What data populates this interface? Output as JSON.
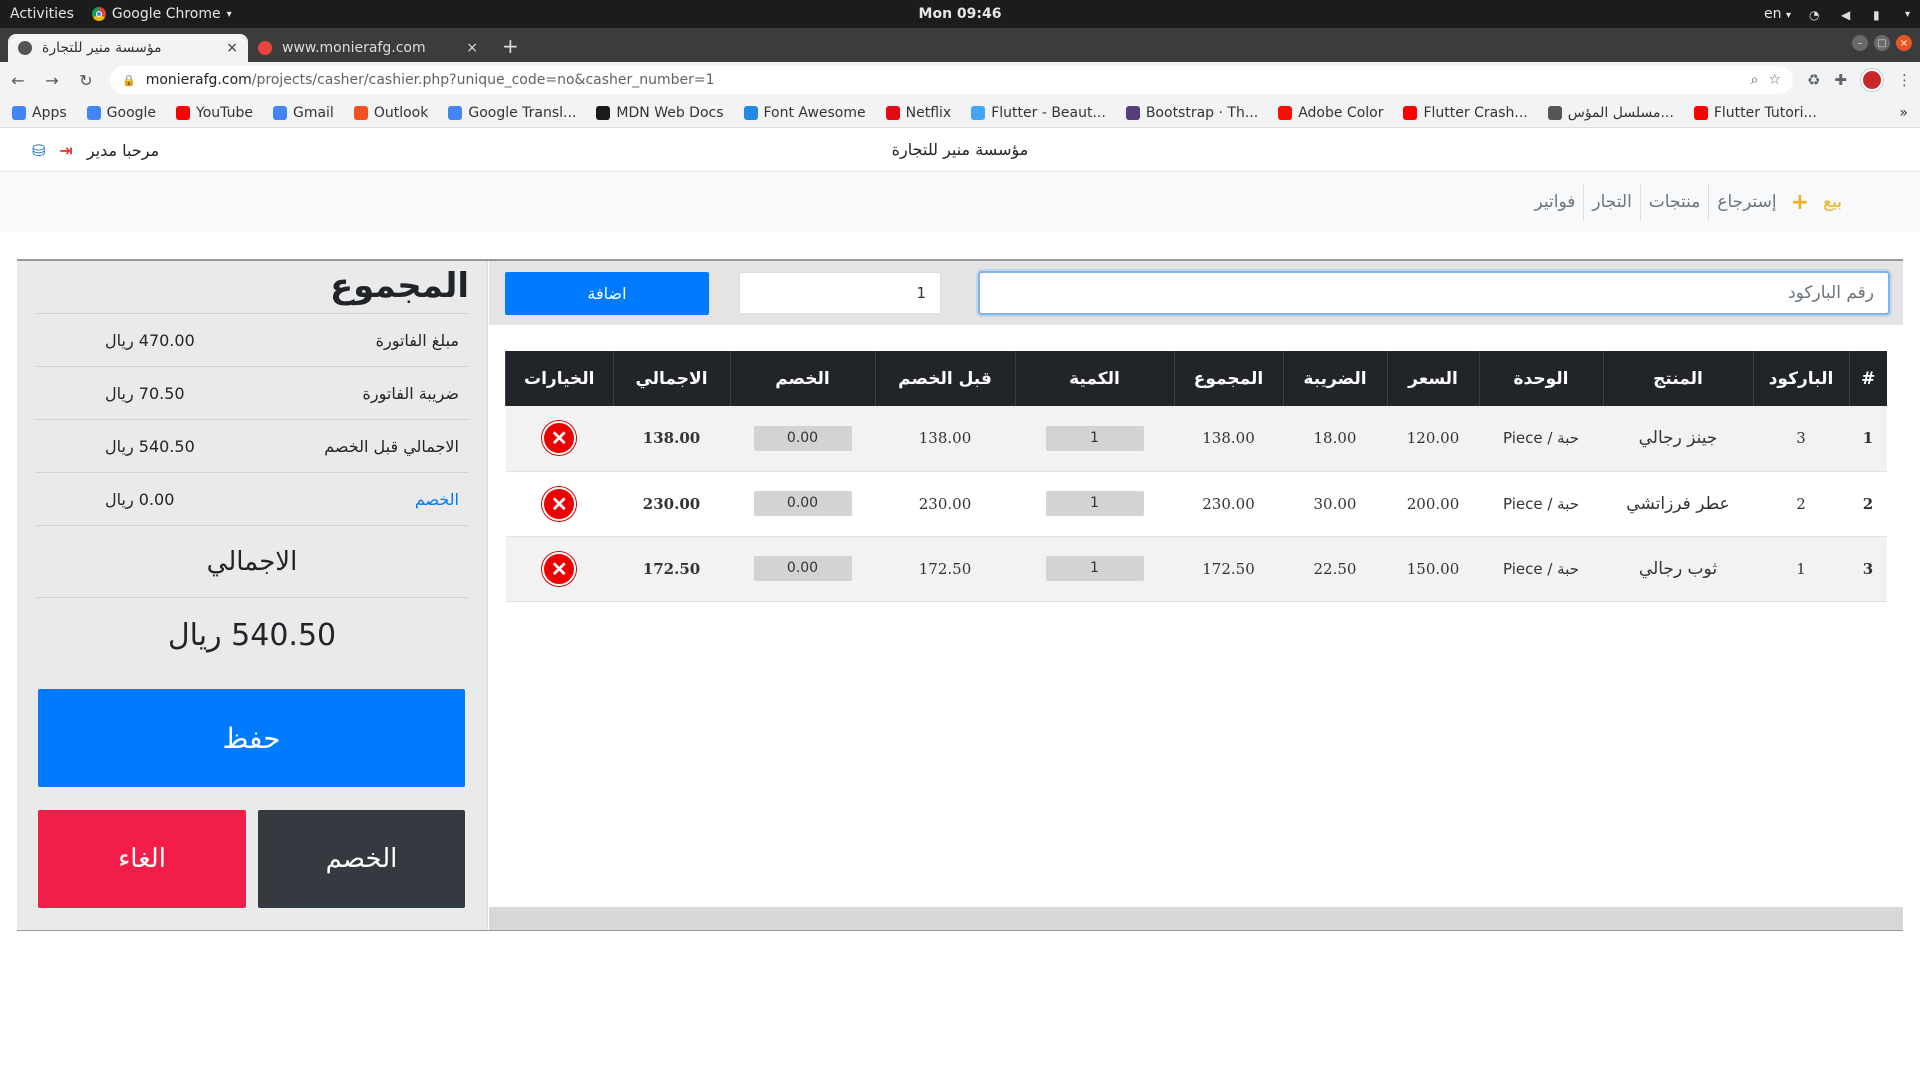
{
  "os": {
    "activities": "Activities",
    "app_name": "Google Chrome",
    "clock": "Mon 09:46",
    "lang": "en"
  },
  "tabs": [
    {
      "title": "مؤسسة منير للتجارة",
      "close": "×"
    },
    {
      "title": "www.monierafg.com",
      "close": "×"
    }
  ],
  "omnibox": {
    "host": "monierafg.com",
    "path": "/projects/casher/cashier.php?unique_code=no&casher_number=1"
  },
  "bookmarks": [
    {
      "label": "Apps",
      "color": "#4285f4"
    },
    {
      "label": "Google",
      "color": "#4285f4"
    },
    {
      "label": "YouTube",
      "color": "#ff0000"
    },
    {
      "label": "Gmail",
      "color": "#4285f4"
    },
    {
      "label": "Outlook",
      "color": "#f25022"
    },
    {
      "label": "Google Transl...",
      "color": "#4285f4"
    },
    {
      "label": "MDN Web Docs",
      "color": "#1b1b1b"
    },
    {
      "label": "Font Awesome",
      "color": "#228ae6"
    },
    {
      "label": "Netflix",
      "color": "#e50914"
    },
    {
      "label": "Flutter - Beaut...",
      "color": "#42a5f5"
    },
    {
      "label": "Bootstrap · Th...",
      "color": "#563d7c"
    },
    {
      "label": "Adobe Color",
      "color": "#fa0f00"
    },
    {
      "label": "Flutter Crash...",
      "color": "#ff0000"
    },
    {
      "label": "مسلسل المؤس...",
      "color": "#555555"
    },
    {
      "label": "Flutter Tutori...",
      "color": "#ff0000"
    }
  ],
  "bookmarks_more": "»",
  "header": {
    "company": "مؤسسة منير للتجارة",
    "welcome": "مرحبا مدير"
  },
  "nav": {
    "sell": "بيع",
    "returns": "إسترجاع",
    "products": "منتجات",
    "merchants": "التجار",
    "invoices": "فواتير"
  },
  "entry": {
    "barcode_placeholder": "رقم الباركود",
    "qty_value": "1",
    "add_label": "اضافة"
  },
  "summary": {
    "title": "المجموع",
    "rows": [
      {
        "label": "مبلغ الفاتورة",
        "value": "470.00 ريال"
      },
      {
        "label": "ضريبة الفاتورة",
        "value": "70.50 ريال"
      },
      {
        "label": "الاجمالي قبل الخصم",
        "value": "540.50 ريال"
      },
      {
        "label": "الخصم",
        "value": "0.00 ريال"
      }
    ],
    "total_label": "الاجمالي",
    "total_value": "540.50 ريال",
    "save_label": "حفظ",
    "discount_label": "الخصم",
    "cancel_label": "الغاء"
  },
  "table": {
    "headers": [
      "#",
      "الباركود",
      "المنتج",
      "الوحدة",
      "السعر",
      "الضريبة",
      "المجموع",
      "الكمية",
      "قبل الخصم",
      "الخصم",
      "الاجمالي",
      "الخيارات"
    ],
    "rows": [
      {
        "idx": "1",
        "barcode": "3",
        "product": "جينز رجالي",
        "unit": "Piece / حبة",
        "price": "120.00",
        "tax": "18.00",
        "sum": "138.00",
        "qty": "1",
        "before_discount": "138.00",
        "discount": "0.00",
        "total": "138.00"
      },
      {
        "idx": "2",
        "barcode": "2",
        "product": "عطر فرزاتشي",
        "unit": "Piece / حبة",
        "price": "200.00",
        "tax": "30.00",
        "sum": "230.00",
        "qty": "1",
        "before_discount": "230.00",
        "discount": "0.00",
        "total": "230.00"
      },
      {
        "idx": "3",
        "barcode": "1",
        "product": "ثوب رجالي",
        "unit": "Piece / حبة",
        "price": "150.00",
        "tax": "22.50",
        "sum": "172.50",
        "qty": "1",
        "before_discount": "172.50",
        "discount": "0.00",
        "total": "172.50"
      }
    ]
  },
  "icons": {
    "delete": "close-circle-icon",
    "database": "database-icon",
    "logout": "logout-icon",
    "plus": "plus-icon"
  },
  "colors": {
    "primary": "#007bff",
    "danger": "#f31d49",
    "dark": "#343a40",
    "accent": "#f0ad1c"
  }
}
